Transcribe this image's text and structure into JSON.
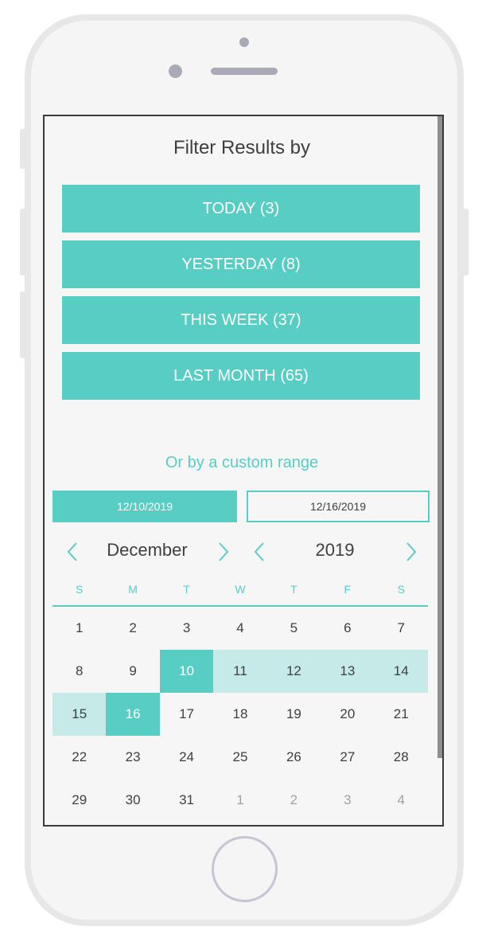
{
  "header": {
    "title": "Filter Results by"
  },
  "filters": [
    {
      "label": "TODAY (3)"
    },
    {
      "label": "YESTERDAY (8)"
    },
    {
      "label": "THIS WEEK (37)"
    },
    {
      "label": "LAST MONTH (65)"
    }
  ],
  "custom": {
    "label": "Or by a custom range",
    "start_date": "12/10/2019",
    "end_date": "12/16/2019"
  },
  "calendar": {
    "month": "December",
    "year": "2019",
    "weekdays": [
      "S",
      "M",
      "T",
      "W",
      "T",
      "F",
      "S"
    ],
    "days": [
      {
        "d": "1"
      },
      {
        "d": "2"
      },
      {
        "d": "3"
      },
      {
        "d": "4"
      },
      {
        "d": "5"
      },
      {
        "d": "6"
      },
      {
        "d": "7"
      },
      {
        "d": "8"
      },
      {
        "d": "9"
      },
      {
        "d": "10",
        "state": "selected"
      },
      {
        "d": "11",
        "state": "in-range"
      },
      {
        "d": "12",
        "state": "in-range"
      },
      {
        "d": "13",
        "state": "in-range"
      },
      {
        "d": "14",
        "state": "in-range"
      },
      {
        "d": "15",
        "state": "in-range"
      },
      {
        "d": "16",
        "state": "selected"
      },
      {
        "d": "17"
      },
      {
        "d": "18"
      },
      {
        "d": "19"
      },
      {
        "d": "20"
      },
      {
        "d": "21"
      },
      {
        "d": "22"
      },
      {
        "d": "23"
      },
      {
        "d": "24"
      },
      {
        "d": "25"
      },
      {
        "d": "26"
      },
      {
        "d": "27"
      },
      {
        "d": "28"
      },
      {
        "d": "29"
      },
      {
        "d": "30"
      },
      {
        "d": "31"
      },
      {
        "d": "1",
        "state": "muted"
      },
      {
        "d": "2",
        "state": "muted"
      },
      {
        "d": "3",
        "state": "muted"
      },
      {
        "d": "4",
        "state": "muted"
      }
    ]
  },
  "colors": {
    "accent": "#57cdc4",
    "range": "#c5eae7",
    "text": "#3f3f3f"
  },
  "icons": {
    "prev": "chevron-left-icon",
    "next": "chevron-right-icon"
  }
}
